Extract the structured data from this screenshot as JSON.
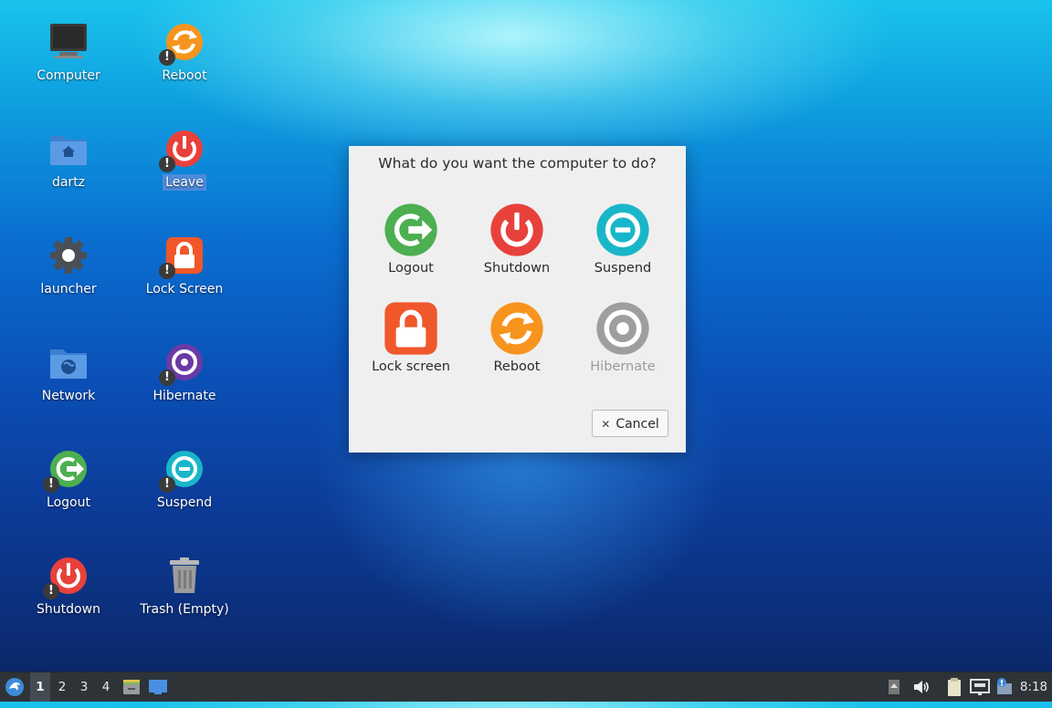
{
  "desktop": {
    "icons": [
      {
        "label": "Computer",
        "icon": "computer-icon",
        "warn": false
      },
      {
        "label": "Reboot",
        "icon": "reboot-icon",
        "warn": true
      },
      {
        "label": "dartz",
        "icon": "home-folder-icon",
        "warn": false
      },
      {
        "label": "Leave",
        "icon": "power-icon",
        "warn": true,
        "selected": true
      },
      {
        "label": "launcher",
        "icon": "gear-icon",
        "warn": false
      },
      {
        "label": "Lock Screen",
        "icon": "lock-icon",
        "warn": true
      },
      {
        "label": "Network",
        "icon": "network-folder-icon",
        "warn": false
      },
      {
        "label": "Hibernate",
        "icon": "hibernate-icon",
        "warn": true
      },
      {
        "label": "Logout",
        "icon": "logout-icon",
        "warn": true
      },
      {
        "label": "Suspend",
        "icon": "suspend-icon",
        "warn": true
      },
      {
        "label": "Shutdown",
        "icon": "shutdown-icon",
        "warn": true
      },
      {
        "label": "Trash (Empty)",
        "icon": "trash-icon",
        "warn": false
      }
    ],
    "warn_glyph": "!"
  },
  "dialog": {
    "title": "What do you want the computer to do?",
    "actions": [
      {
        "label": "Logout",
        "icon": "logout-icon",
        "color": "#4caf50",
        "enabled": true
      },
      {
        "label": "Shutdown",
        "icon": "shutdown-icon",
        "color": "#e8413c",
        "enabled": true
      },
      {
        "label": "Suspend",
        "icon": "suspend-icon",
        "color": "#19b6c9",
        "enabled": true
      },
      {
        "label": "Lock screen",
        "icon": "lock-icon",
        "color": "#f0572a",
        "enabled": true
      },
      {
        "label": "Reboot",
        "icon": "reboot-icon",
        "color": "#f7941d",
        "enabled": true
      },
      {
        "label": "Hibernate",
        "icon": "hibernate-icon",
        "color": "#9e9e9e",
        "enabled": false
      }
    ],
    "cancel_glyph": "✕",
    "cancel_label": "Cancel"
  },
  "taskbar": {
    "workspaces": [
      "1",
      "2",
      "3",
      "4"
    ],
    "active_workspace": "1",
    "clock": "8:18"
  },
  "colors": {
    "taskbar_bg": "#2e3338",
    "dialog_bg": "#efefef",
    "selection": "#5a8cdc"
  }
}
